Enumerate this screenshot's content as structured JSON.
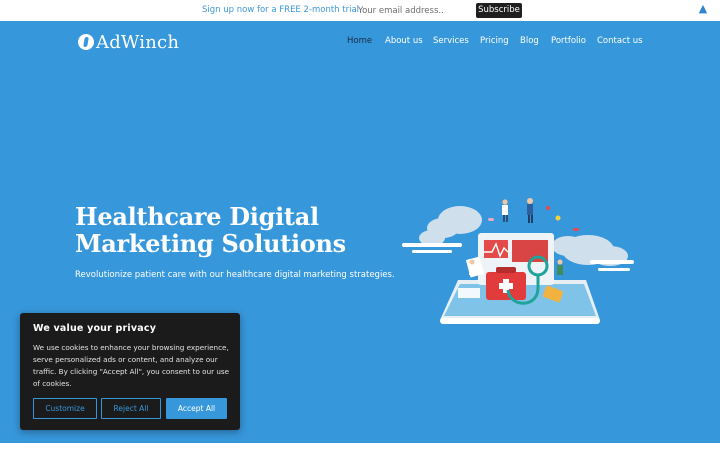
{
  "topbar": {
    "promo_text": "Sign up now for a FREE 2-month trial.",
    "email_placeholder": "Your email address..",
    "subscribe_label": "Subscribe",
    "collapse_icon": "triangle-up"
  },
  "brand": {
    "logo_text": "AdWinch",
    "logo_icon": "info-circle-logo",
    "primary_color": "#3797db"
  },
  "nav": {
    "items": [
      {
        "label": "Home",
        "active": true
      },
      {
        "label": "About us"
      },
      {
        "label": "Services"
      },
      {
        "label": "Pricing"
      },
      {
        "label": "Blog"
      },
      {
        "label": "Portfolio"
      },
      {
        "label": "Contact us"
      }
    ]
  },
  "hero": {
    "title_line1": "Healthcare Digital",
    "title_line2": "Marketing Solutions",
    "tagline": "Revolutionize patient care with our healthcare digital marketing strategies.",
    "illustration": "healthcare-tablet-illustration"
  },
  "cookie": {
    "title": "We value your privacy",
    "body": "We use cookies to enhance your browsing experience, serve personalized ads or content, and analyze our traffic. By clicking \"Accept All\", you consent to our use of cookies.",
    "customize_label": "Customize",
    "reject_label": "Reject All",
    "accept_label": "Accept All"
  }
}
